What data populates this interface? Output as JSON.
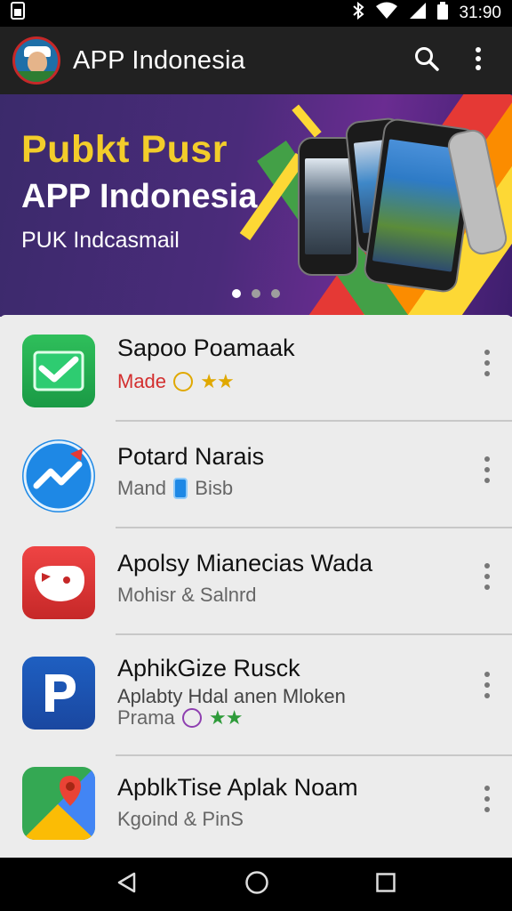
{
  "status_bar": {
    "time": "31:90"
  },
  "app_bar": {
    "title": "APP Indonesia"
  },
  "banner": {
    "title": "Pubkt Pusr",
    "subtitle": "APP Indonesia",
    "tagline": "PUK Indcasmail",
    "page_count": 3,
    "active_page": 1
  },
  "apps": [
    {
      "name": "Sapoo Poamaak",
      "sub_prefix": "Made",
      "rating_stars": "★★"
    },
    {
      "name": "Potard Narais",
      "sub_left": "Mand",
      "sub_right": "Bisb"
    },
    {
      "name": "Apolsy Mianecias Wada",
      "sub": "Mohisr & Salnrd"
    },
    {
      "name": "AphikGize Rusck",
      "sub": "Aplabty Hdal anen Mloken",
      "sub2_prefix": "Prama",
      "rating_stars": "★★"
    },
    {
      "name": "ApblkTise Aplak Noam",
      "sub": "Kgoind & PinS"
    }
  ],
  "colors": {
    "banner_yellow": "#f3cd2a",
    "accent_red": "#d32f2f",
    "star_gold": "#e0a800",
    "star_green": "#2e9b3a"
  }
}
